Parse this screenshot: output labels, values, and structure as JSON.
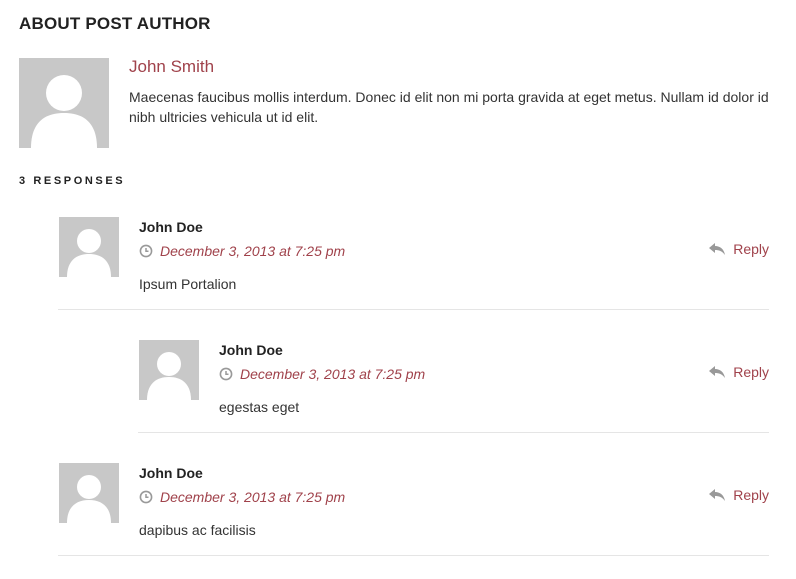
{
  "about": {
    "title": "ABOUT POST AUTHOR",
    "author_name": "John Smith",
    "author_bio": "Maecenas faucibus mollis interdum. Donec id elit non mi porta gravida at eget metus. Nullam id dolor id nibh ultricies vehicula ut id elit."
  },
  "responses": {
    "title": "3 RESPONSES",
    "reply_label": "Reply",
    "comments": [
      {
        "author": "John Doe",
        "date": "December 3, 2013 at 7:25 pm",
        "text": "Ipsum Portalion",
        "depth": 1
      },
      {
        "author": "John Doe",
        "date": "December 3, 2013 at 7:25 pm",
        "text": "egestas eget",
        "depth": 2
      },
      {
        "author": "John Doe",
        "date": "December 3, 2013 at 7:25 pm",
        "text": "dapibus ac facilisis",
        "depth": 1
      }
    ]
  },
  "icons": {
    "avatar": "default-avatar-icon",
    "clock": "clock-icon",
    "reply": "reply-arrow-icon"
  },
  "colors": {
    "accent": "#a0424b",
    "text": "#333333",
    "heading": "#222222",
    "avatar_bg": "#c8c8c8",
    "icon_gray": "#999999",
    "divider": "#e5e5e5"
  }
}
